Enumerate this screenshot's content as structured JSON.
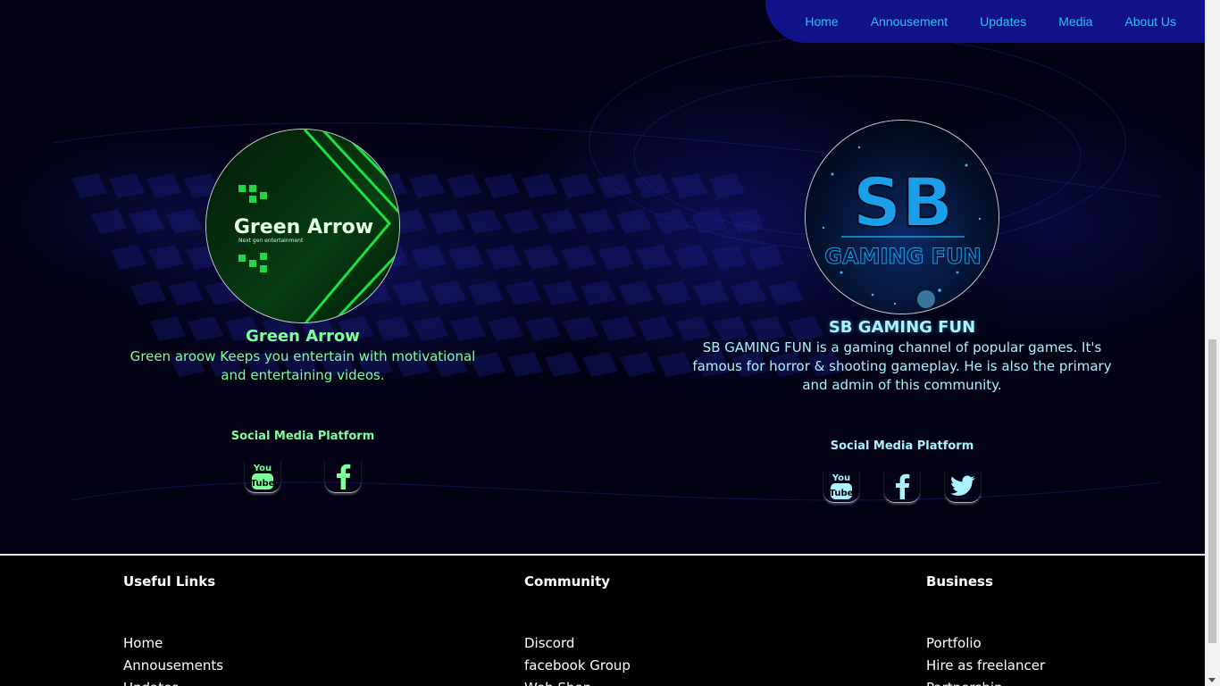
{
  "nav": {
    "items": [
      "Home",
      "Annousement",
      "Updates",
      "Media",
      "About Us"
    ]
  },
  "cards": [
    {
      "avatar_text": "Green Arrow",
      "avatar_subtext": "Next gen entertainment",
      "name": "Green Arrow",
      "description": "Green aroow Keeps you entertain with motivational and entertaining videos.",
      "platform_label": "Social Media Platform",
      "socials": [
        "youtube-icon",
        "facebook-icon"
      ],
      "accent": "#7dff9a"
    },
    {
      "avatar_text": "SB",
      "avatar_subtext": "GAMING FUN",
      "name": "SB GAMING FUN",
      "description": "SB GAMING FUN is a gaming channel of popular games. It's famous for horror & shooting gameplay. He is also the primary and admin of this community.",
      "platform_label": "Social Media Platform",
      "socials": [
        "youtube-icon",
        "facebook-icon",
        "twitter-icon"
      ],
      "accent": "#a9f2ff"
    }
  ],
  "footer": {
    "columns": [
      {
        "title": "Useful Links",
        "links": [
          "Home",
          "Annousements",
          "Updates"
        ]
      },
      {
        "title": "Community",
        "links": [
          "Discord",
          "facebook Group",
          "Web Shop"
        ]
      },
      {
        "title": "Business",
        "links": [
          "Portfolio",
          "Hire as freelancer",
          "Partnership"
        ]
      }
    ]
  },
  "colors": {
    "nav_bg": "#11128a",
    "nav_link": "#2bc3ee",
    "green_accent": "#7dff9a",
    "blue_accent": "#a9f2ff"
  }
}
